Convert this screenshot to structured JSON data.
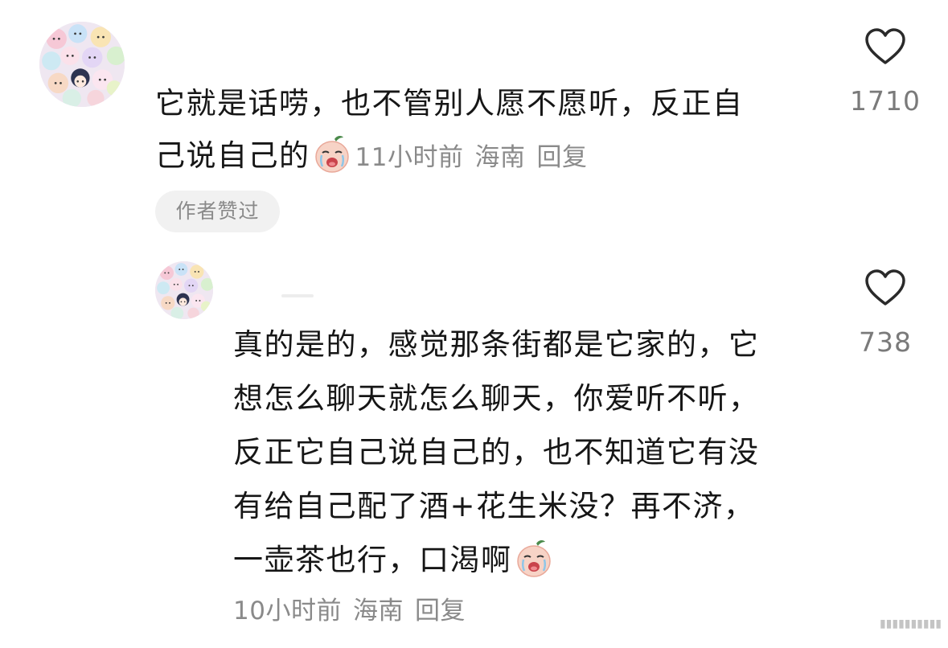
{
  "comments": [
    {
      "text_line1": "它就是话唠，也不管别人愿不愿听，反正自",
      "text_line2": "己说自己的",
      "emoji": "crying-peach-emoji",
      "time": "11小时前",
      "location": "海南",
      "reply_label": "回复",
      "likes": "1710",
      "author_badge": "作者赞过"
    },
    {
      "text_lines": [
        "真的是的，感觉那条街都是它家的，它",
        "想怎么聊天就怎么聊天，你爱听不听，",
        "反正它自己说自己的，也不知道它有没",
        "有给自己配了酒+花生米没？再不济，",
        "一壶茶也行，口渴啊"
      ],
      "emoji": "crying-peach-emoji",
      "time": "10小时前",
      "location": "海南",
      "reply_label": "回复",
      "likes": "738"
    }
  ],
  "icons": {
    "like": "heart-outline-icon",
    "avatar": "cartoon-collage-avatar"
  },
  "colors": {
    "text": "#161616",
    "meta": "#8a8a8a",
    "like_count": "#7a7a7a",
    "badge_bg": "#f1f1f1",
    "emoji_face": "#f7d3c6",
    "emoji_leaf": "#4b8a4b"
  }
}
